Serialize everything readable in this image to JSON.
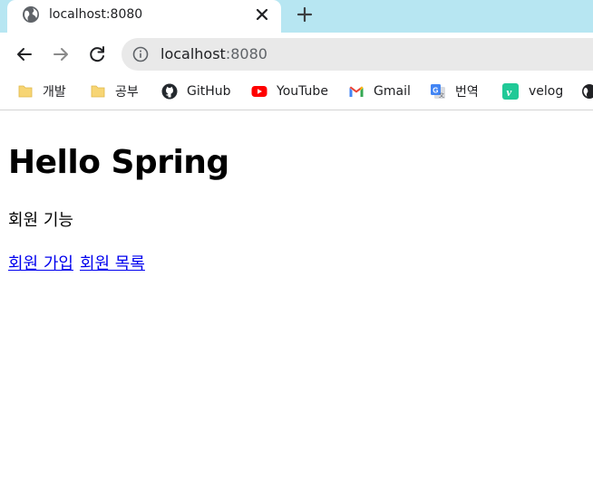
{
  "browser": {
    "tab": {
      "title": "localhost:8080",
      "favicon": "globe-icon"
    },
    "address_bar": {
      "host": "localhost",
      "port": ":8080"
    },
    "bookmarks": [
      {
        "label": "개발",
        "icon": "folder-icon"
      },
      {
        "label": "공부",
        "icon": "folder-icon"
      },
      {
        "label": "GitHub",
        "icon": "github-icon"
      },
      {
        "label": "YouTube",
        "icon": "youtube-icon"
      },
      {
        "label": "Gmail",
        "icon": "gmail-icon"
      },
      {
        "label": "번역",
        "icon": "google-translate-icon"
      },
      {
        "label": "velog",
        "icon": "velog-icon"
      }
    ]
  },
  "page": {
    "heading": "Hello Spring",
    "subtitle": "회원 기능",
    "links": {
      "join": "회원 가입",
      "list": "회원 목록"
    }
  },
  "colors": {
    "tab_strip": "#b7e6f2",
    "link": "#0000ee",
    "youtube": "#ff0000",
    "velog": "#20c997"
  }
}
